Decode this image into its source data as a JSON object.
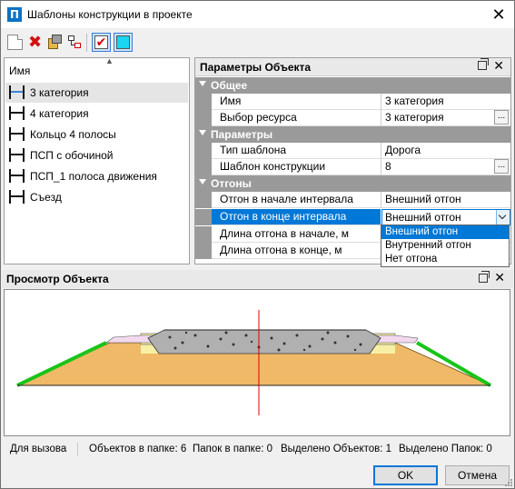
{
  "window": {
    "title": "Шаблоны конструкции в проекте",
    "icon_letter": "П",
    "close_glyph": "✕"
  },
  "toolbar": {
    "buttons": [
      {
        "name": "new-icon"
      },
      {
        "name": "delete-icon",
        "glyph": "✖"
      },
      {
        "name": "properties-icon"
      },
      {
        "name": "tree-icon"
      },
      {
        "name": "show-check-icon",
        "glyph": "✔"
      },
      {
        "name": "fill-icon"
      }
    ]
  },
  "list": {
    "header": "Имя",
    "sort_glyph": "▲",
    "items": [
      {
        "label": "3 категория",
        "selected": true
      },
      {
        "label": "4 категория",
        "selected": false
      },
      {
        "label": "Кольцо 4 полосы",
        "selected": false
      },
      {
        "label": "ПСП с обочиной",
        "selected": false
      },
      {
        "label": "ПСП_1 полоса движения",
        "selected": false
      },
      {
        "label": "Съезд",
        "selected": false
      }
    ]
  },
  "properties": {
    "title": "Параметры Объекта",
    "close_glyph": "✕",
    "categories": [
      {
        "label": "Общее",
        "rows": [
          {
            "name": "Имя",
            "value": "3 категория"
          },
          {
            "name": "Выбор ресурса",
            "value": "3 категория",
            "ellipsis": "..."
          }
        ]
      },
      {
        "label": "Параметры",
        "rows": [
          {
            "name": "Тип шаблона",
            "value": "Дорога"
          },
          {
            "name": "Шаблон конструкции",
            "value": "8",
            "ellipsis": "..."
          }
        ]
      },
      {
        "label": "Отгоны",
        "rows": [
          {
            "name": "Отгон в начале интервала",
            "value": "Внешний отгон"
          },
          {
            "name": "Отгон в конце интервала",
            "value": "Внешний отгон"
          },
          {
            "name": "Длина отгона в начале, м",
            "value": ""
          },
          {
            "name": "Длина отгона в конце, м",
            "value": ""
          }
        ]
      }
    ],
    "dropdown_options": [
      "Внешний отгон",
      "Внутренний отгон",
      "Нет отгона"
    ],
    "dropdown_selected": "Внешний отгон"
  },
  "preview": {
    "title": "Просмотр Объекта",
    "close_glyph": "✕",
    "colors": {
      "slope": "#18c418",
      "base": "#efb967",
      "layer": "#f7f0a4",
      "top": "#f2d9ee",
      "gravel": "#b0b0b0",
      "axis": "#e00000"
    }
  },
  "status": {
    "hint": "Для вызова контекстного меню",
    "objects_in_folder": "Объектов в папке: 6",
    "folders_in_folder": "Папок в папке: 0",
    "selected_objects": "Выделено Объектов: 1",
    "selected_folders": "Выделено Папок: 0"
  },
  "buttons": {
    "ok": "OK",
    "cancel": "Отмена"
  }
}
